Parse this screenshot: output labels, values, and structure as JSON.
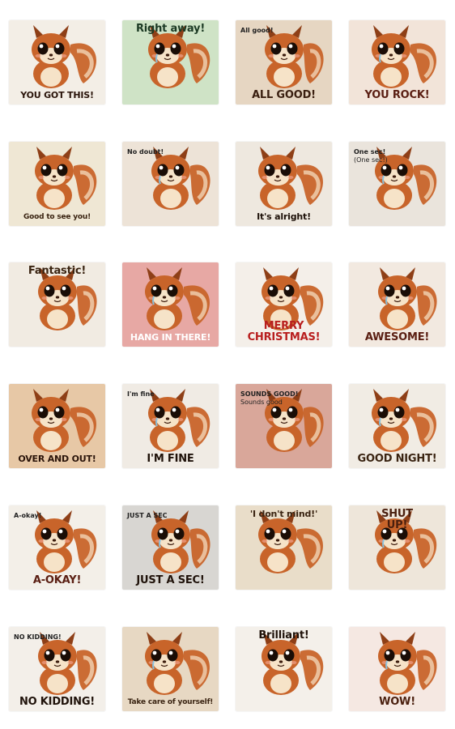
{
  "colors": {
    "fur": "#c8642a",
    "fur_dark": "#8e3f17",
    "belly": "#f6e3c8",
    "text_dark": "#4a1f0e",
    "text_red": "#b0341c"
  },
  "stickers": [
    {
      "caption": "YOU GOT THIS!",
      "bg": "#f3eee6",
      "color": "#2a140a",
      "icon": "squirrel-icon"
    },
    {
      "caption": "Right away!",
      "bg": "#cfe3c6",
      "color": "#1c3a24",
      "icon": "squirrel-icon",
      "top": true
    },
    {
      "caption": "ALL GOOD!",
      "bubble": "All good!",
      "bg": "#e6d6c2",
      "color": "#3a1f10",
      "icon": "squirrel-icon"
    },
    {
      "caption": "YOU ROCK!",
      "bg": "#f2e4d9",
      "color": "#5a1e12",
      "icon": "squirrel-icon"
    },
    {
      "caption": "Good to see you!",
      "bg": "#efe7d4",
      "color": "#3a2412",
      "icon": "squirrel-icon"
    },
    {
      "bubble": "No doubt!",
      "bg": "#ede3d7",
      "color": "#222",
      "icon": "squirrel-icon"
    },
    {
      "caption": "It's alright!",
      "bg": "#eee8df",
      "color": "#1f120a",
      "icon": "squirrel-icon"
    },
    {
      "bubble": "One sec!",
      "bubble2": "(One sec!)",
      "bg": "#eae4dc",
      "color": "#222",
      "icon": "squirrel-icon"
    },
    {
      "caption": "Fantastic!",
      "bg": "#f1ebe2",
      "color": "#3a2412",
      "icon": "squirrel-icon",
      "top": true
    },
    {
      "caption": "HANG IN THERE!",
      "bg": "#e7a8a4",
      "color": "#ffffff",
      "icon": "squirrel-icon"
    },
    {
      "caption": "MERRY",
      "caption2": "CHRISTMAS!",
      "bg": "#f4efe9",
      "color": "#b81e1e",
      "icon": "squirrel-icon"
    },
    {
      "caption": "AWESOME!",
      "bg": "#f2e9e0",
      "color": "#5a1e12",
      "icon": "squirrel-icon"
    },
    {
      "caption": "OVER AND OUT!",
      "bg": "#e7c8a6",
      "color": "#2a140a",
      "icon": "squirrel-icon"
    },
    {
      "caption": "I'M FINE",
      "bubble": "I'm fine",
      "bg": "#f0ebe4",
      "color": "#1f120a",
      "icon": "squirrel-icon"
    },
    {
      "bubble": "SOUNDS GOOD!",
      "bubble2": "Sounds good",
      "bg": "#d9a79a",
      "color": "#222",
      "icon": "squirrel-icon"
    },
    {
      "caption": "GOOD NIGHT!",
      "bg": "#f1ece4",
      "color": "#3a2412",
      "icon": "squirrel-icon"
    },
    {
      "caption": "A-OKAY!",
      "bubble": "A-okay!",
      "bg": "#f3efe8",
      "color": "#5a1e12",
      "icon": "squirrel-icon"
    },
    {
      "caption": "JUST A SEC!",
      "bubble": "JUST A SEC",
      "bg": "#d8d6d2",
      "color": "#1f120a",
      "icon": "squirrel-icon"
    },
    {
      "caption": "'I don't mind!'",
      "bg": "#e9ddc9",
      "color": "#3a2412",
      "icon": "squirrel-icon",
      "top": true
    },
    {
      "caption": "SHUT",
      "caption2": "UP!",
      "bg": "#eee6da",
      "color": "#4a1f0e",
      "icon": "squirrel-icon",
      "top": true
    },
    {
      "caption": "NO KIDDING!",
      "bubble": "NO KIDDING!",
      "bg": "#f3efe9",
      "color": "#1f120a",
      "icon": "squirrel-icon"
    },
    {
      "caption": "Take care of yourself!",
      "bg": "#e7d8c3",
      "color": "#3a2412",
      "icon": "squirrel-icon"
    },
    {
      "caption": "Brilliant!",
      "bg": "#f4f0ea",
      "color": "#1f120a",
      "icon": "squirrel-icon",
      "top": true
    },
    {
      "caption": "WOW!",
      "bg": "#f5e8e2",
      "color": "#4a1f0e",
      "icon": "squirrel-icon"
    }
  ]
}
